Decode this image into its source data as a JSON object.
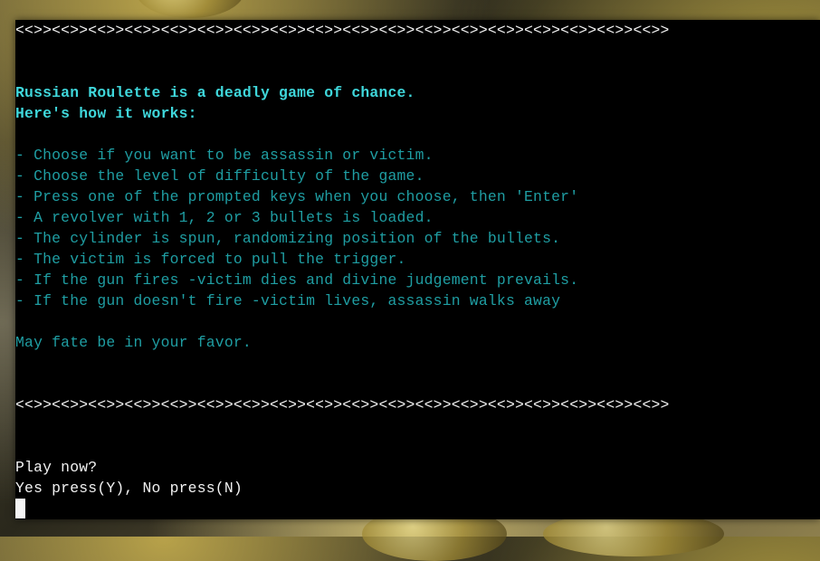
{
  "terminal": {
    "divider_top": "<<>><<>><<>><<>><<>><<>><<>><<>><<>><<>><<>><<>><<>><<>><<>><<>><<>><<>>",
    "intro": [
      "Russian Roulette is a deadly game of chance.",
      "Here's how it works:"
    ],
    "rules": [
      "- Choose if you want to be assassin or victim.",
      "- Choose the level of difficulty of the game.",
      "- Press one of the prompted keys when you choose, then 'Enter'",
      "- A revolver with 1, 2 or 3 bullets is loaded.",
      "- The cylinder is spun, randomizing position of the bullets.",
      "- The victim is forced to pull the trigger.",
      "- If the gun fires -victim dies and divine judgement prevails.",
      "- If the gun doesn't fire -victim lives, assassin walks away"
    ],
    "closing": "May fate be in your favor.",
    "divider_bottom": "<<>><<>><<>><<>><<>><<>><<>><<>><<>><<>><<>><<>><<>><<>><<>><<>><<>><<>>",
    "prompt": "Play now?",
    "options": "Yes press(Y), No press(N)"
  },
  "colors": {
    "terminal_bg": "#000000",
    "heading": "#3fd7db",
    "body_text": "#1f9ea3",
    "prompt_text": "#f2f2f2"
  }
}
